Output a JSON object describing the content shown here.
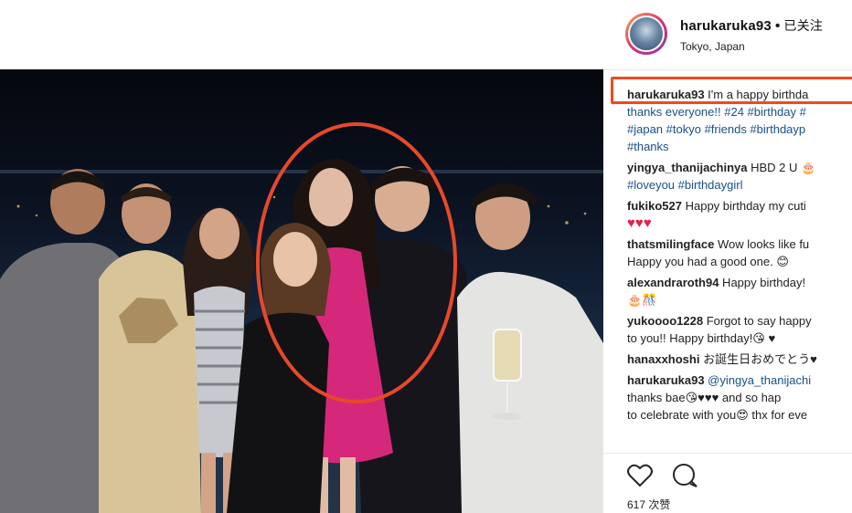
{
  "post": {
    "username": "harukaruka93",
    "separator": "•",
    "follow_status": "已关注",
    "location": "Tokyo, Japan",
    "caption_user": "harukaruka93",
    "caption_text": " I'm a happy birthda",
    "caption_line2": "thanks everyone!! #24 #birthday #",
    "caption_line3": "#japan #tokyo #friends #birthdayp",
    "caption_line4": "#thanks"
  },
  "comments": [
    {
      "user": "yingya_thanijachinya",
      "text": " HBD 2 U 🎂",
      "line2": "#loveyou #birthdaygirl"
    },
    {
      "user": "fukiko527",
      "text": " Happy birthday my cuti",
      "line2": "♥♥♥"
    },
    {
      "user": "thatsmilingface",
      "text": " Wow looks like fu",
      "line2": "Happy you had a good one. 😊"
    },
    {
      "user": "alexandraroth94",
      "text": " Happy birthday!",
      "line2": "🎂🎊"
    },
    {
      "user": "yukoooo1228",
      "text": " Forgot to say happy",
      "line2": "to you!! Happy birthday!😘 ♥"
    },
    {
      "user": "hanaxxhoshi",
      "text": " お誕生日おめでとう♥"
    },
    {
      "user": "harukaruka93",
      "mention": " @yingya_thanijachi",
      "line2": "thanks bae😘♥♥♥ and so hap",
      "line3": "to celebrate with you😍 thx for eve"
    }
  ],
  "actions": {
    "like_icon": "heart-outline-icon",
    "comment_icon": "comment-bubble-icon"
  },
  "likes_text": "617 次赞",
  "colors": {
    "highlight": "#ef4a1f",
    "circle": "#e8482a",
    "hashtag": "#1a4f8a"
  }
}
